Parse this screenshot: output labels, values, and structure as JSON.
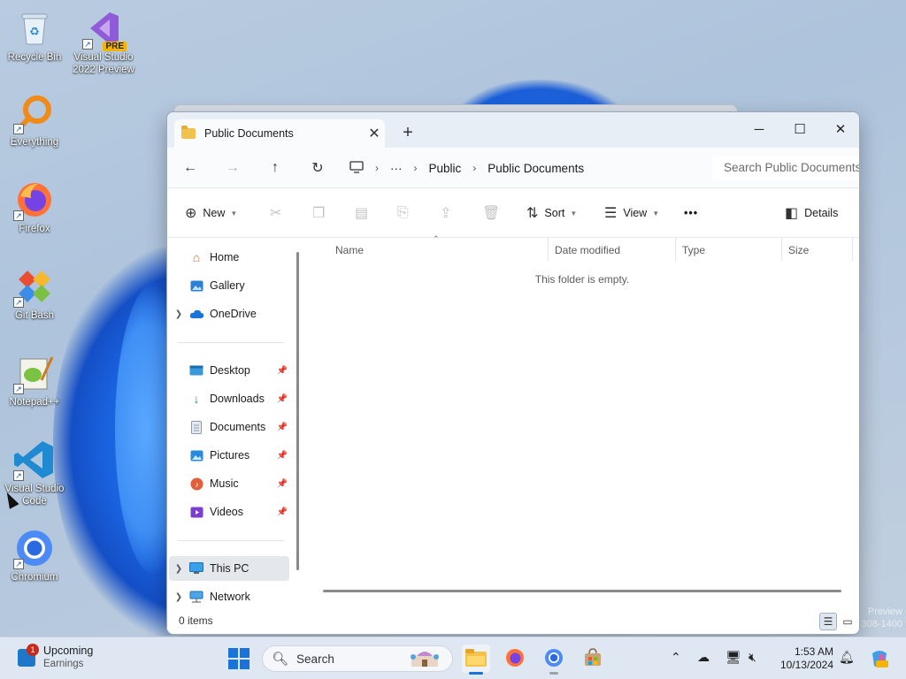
{
  "desktop": {
    "icons": [
      {
        "label": "Recycle Bin",
        "icon": "recycle-bin-icon"
      },
      {
        "label": "Visual Studio 2022 Preview",
        "icon": "visual-studio-icon",
        "badge": "PRE"
      },
      {
        "label": "Everything",
        "icon": "everything-search-icon"
      },
      {
        "label": "Firefox",
        "icon": "firefox-icon"
      },
      {
        "label": "Git Bash",
        "icon": "git-bash-icon"
      },
      {
        "label": "Notepad++",
        "icon": "notepadpp-icon"
      },
      {
        "label": "Visual Studio Code",
        "icon": "vscode-icon"
      },
      {
        "label": "Chromium",
        "icon": "chromium-icon"
      }
    ],
    "watermark_line1": "Preview",
    "watermark_line2": "308-1400"
  },
  "explorer": {
    "tab_title": "Public Documents",
    "tab_close": "✕",
    "new_tab": "+",
    "window_controls": {
      "minimize": "─",
      "maximize": "☐",
      "close": "✕"
    },
    "nav": {
      "back": "←",
      "forward": "→",
      "up": "↑",
      "refresh": "↻"
    },
    "breadcrumb": {
      "pc_icon": "monitor-icon",
      "sep": "›",
      "more": "···",
      "items": [
        "Public",
        "Public Documents"
      ]
    },
    "search_placeholder": "Search Public Documents",
    "toolbar": {
      "new_label": "New",
      "sort_label": "Sort",
      "view_label": "View",
      "more_label": "•••",
      "details_label": "Details",
      "disabled_icons": [
        "cut-icon",
        "copy-icon",
        "paste-icon",
        "rename-icon",
        "share-icon",
        "delete-icon"
      ]
    },
    "navpane": {
      "group1": [
        {
          "label": "Home",
          "icon": "home-icon",
          "expandable": false
        },
        {
          "label": "Gallery",
          "icon": "gallery-icon",
          "expandable": false
        },
        {
          "label": "OneDrive",
          "icon": "onedrive-icon",
          "expandable": true
        }
      ],
      "group2": [
        {
          "label": "Desktop",
          "icon": "desktop-folder-icon",
          "pinned": true
        },
        {
          "label": "Downloads",
          "icon": "downloads-icon",
          "pinned": true
        },
        {
          "label": "Documents",
          "icon": "documents-icon",
          "pinned": true
        },
        {
          "label": "Pictures",
          "icon": "pictures-icon",
          "pinned": true
        },
        {
          "label": "Music",
          "icon": "music-icon",
          "pinned": true
        },
        {
          "label": "Videos",
          "icon": "videos-icon",
          "pinned": true
        }
      ],
      "group3": [
        {
          "label": "This PC",
          "icon": "this-pc-icon",
          "expandable": true,
          "selected": true
        },
        {
          "label": "Network",
          "icon": "network-icon",
          "expandable": true
        }
      ]
    },
    "columns": [
      "Name",
      "Date modified",
      "Type",
      "Size"
    ],
    "empty_message": "This folder is empty.",
    "status": "0 items"
  },
  "taskbar": {
    "widget_title": "Upcoming",
    "widget_subtitle": "Earnings",
    "widget_badge": "1",
    "search_label": "Search",
    "apps": [
      "file-explorer-icon",
      "firefox-icon",
      "chromium-icon",
      "store-icon"
    ],
    "tray_icons": [
      "chevron-up-icon",
      "onedrive-offline-icon",
      "network-icon",
      "volume-muted-icon"
    ],
    "time": "1:53 AM",
    "date": "10/13/2024"
  },
  "colors": {
    "accent": "#1a73d9",
    "taskbar_bg": "#dfe8f2",
    "selected_nav": "#e4e8ed"
  }
}
